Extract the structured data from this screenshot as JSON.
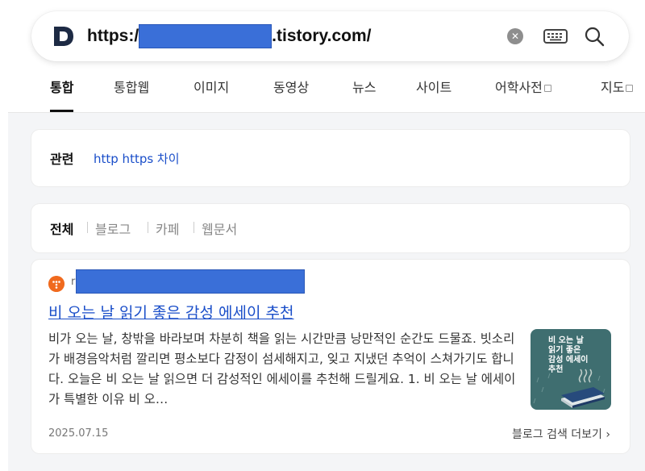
{
  "search": {
    "logo_icon": "daum-d-logo",
    "url_prefix": "https:/",
    "url_suffix": ".tistory.com/",
    "clear_icon": "clear-x-icon",
    "keyboard_icon": "keyboard-icon",
    "search_icon": "search-icon"
  },
  "tabs": [
    {
      "label": "통합",
      "active": true
    },
    {
      "label": "통합웹"
    },
    {
      "label": "이미지"
    },
    {
      "label": "동영상"
    },
    {
      "label": "뉴스"
    },
    {
      "label": "사이트"
    },
    {
      "label": "어학사전",
      "external": true
    },
    {
      "label": "지도",
      "external": true
    }
  ],
  "related": {
    "title": "관련",
    "link": "http https 차이"
  },
  "filters": [
    {
      "label": "전체",
      "active": true
    },
    {
      "label": "블로그"
    },
    {
      "label": "카페"
    },
    {
      "label": "웹문서"
    }
  ],
  "result": {
    "source_prefix": "r",
    "title": "비 오는 날 읽기 좋은 감성 에세이 추천",
    "snippet": "비가 오는 날, 창밖을 바라보며 차분히 책을 읽는 시간만큼 낭만적인 순간도 드물죠. 빗소리가 배경음악처럼 깔리면 평소보다 감정이 섬세해지고, 잊고 지냈던 추억이 스쳐가기도 합니다. 오늘은 비 오는 날 읽으면 더 감성적인 에세이를 추천해 드릴게요. 1. 비 오는 날 에세이가 특별한 이유 비 오…",
    "thumbnail_text": "비 오는 날\n읽기 좋은\n감성 에세이\n추천",
    "date": "2025.07.15",
    "more_link": "블로그 검색 더보기"
  },
  "colors": {
    "link": "#1a4ec9",
    "redaction": "#3a6fd8",
    "source_icon": "#f06a1e",
    "background": "#f4f5f7"
  }
}
